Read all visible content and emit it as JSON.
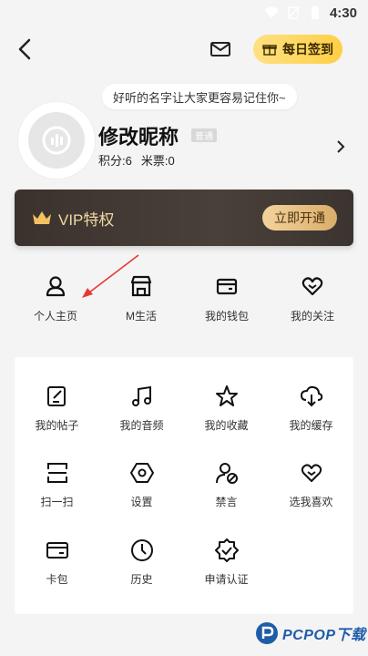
{
  "status_bar": {
    "time": "4:30",
    "icons": [
      "wifi-icon",
      "no-sim-icon",
      "battery-icon"
    ]
  },
  "header": {
    "signin_label": "每日签到",
    "icons": [
      "back-icon",
      "mail-icon",
      "gift-icon"
    ]
  },
  "profile": {
    "bubble_text": "好听的名字让大家更容易记住你~",
    "nickname": "修改昵称",
    "badge": "普通",
    "points": "积分:6",
    "tickets": "米票:0"
  },
  "vip": {
    "title": "VIP特权",
    "button": "立即开通",
    "accent": "#f0d7a4"
  },
  "quick_actions": [
    {
      "label": "个人主页",
      "icon": "person-icon"
    },
    {
      "label": "M生活",
      "icon": "shop-icon"
    },
    {
      "label": "我的钱包",
      "icon": "wallet-icon"
    },
    {
      "label": "我的关注",
      "icon": "heart-icon"
    }
  ],
  "grid_items": [
    {
      "label": "我的帖子",
      "icon": "edit-note-icon"
    },
    {
      "label": "我的音频",
      "icon": "music-icon"
    },
    {
      "label": "我的收藏",
      "icon": "star-icon"
    },
    {
      "label": "我的缓存",
      "icon": "cloud-download-icon"
    },
    {
      "label": "扫一扫",
      "icon": "scan-icon"
    },
    {
      "label": "设置",
      "icon": "settings-icon"
    },
    {
      "label": "禁言",
      "icon": "user-mute-icon"
    },
    {
      "label": "选我喜欢",
      "icon": "heart-check-icon"
    },
    {
      "label": "卡包",
      "icon": "card-icon"
    },
    {
      "label": "历史",
      "icon": "clock-icon"
    },
    {
      "label": "申请认证",
      "icon": "verified-icon"
    }
  ],
  "watermark": {
    "brand": "PCPOP下载"
  },
  "colors": {
    "signin_bg": "#ffcf45",
    "vip_bg": "#3a322d",
    "annotation_arrow": "#e53935"
  }
}
